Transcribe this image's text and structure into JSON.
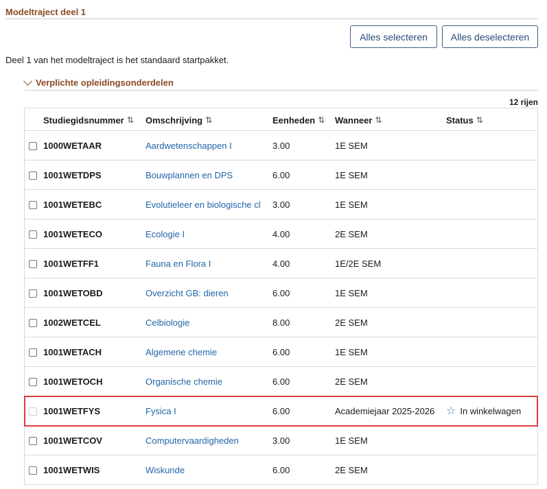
{
  "section": {
    "title": "Modeltraject deel 1",
    "intro": "Deel 1 van het modeltraject is het standaard startpakket."
  },
  "buttons": {
    "select_all": "Alles selecteren",
    "deselect_all": "Alles deselecteren"
  },
  "subsection": {
    "title": "Verplichte opleidingsonderdelen",
    "row_count": "12 rijen"
  },
  "table": {
    "headers": {
      "code": "Studiegidsnummer",
      "description": "Omschrijving",
      "units": "Eenheden",
      "when": "Wanneer",
      "status": "Status"
    },
    "sort_icon": "⇅",
    "rows": [
      {
        "code": "1000WETAAR",
        "description": "Aardwetenschappen I",
        "units": "3.00",
        "when": "1E SEM",
        "status": ""
      },
      {
        "code": "1001WETDPS",
        "description": "Bouwplannen en DPS",
        "units": "6.00",
        "when": "1E SEM",
        "status": ""
      },
      {
        "code": "1001WETEBC",
        "description": "Evolutieleer en biologische cl",
        "units": "3.00",
        "when": "1E SEM",
        "status": ""
      },
      {
        "code": "1001WETECO",
        "description": "Ecologie I",
        "units": "4.00",
        "when": "2E SEM",
        "status": ""
      },
      {
        "code": "1001WETFF1",
        "description": "Fauna en Flora I",
        "units": "4.00",
        "when": "1E/2E SEM",
        "status": ""
      },
      {
        "code": "1001WETOBD",
        "description": "Overzicht GB: dieren",
        "units": "6.00",
        "when": "1E SEM",
        "status": ""
      },
      {
        "code": "1002WETCEL",
        "description": "Celbiologie",
        "units": "8.00",
        "when": "2E SEM",
        "status": ""
      },
      {
        "code": "1001WETACH",
        "description": "Algemene chemie",
        "units": "6.00",
        "when": "1E SEM",
        "status": ""
      },
      {
        "code": "1001WETOCH",
        "description": "Organische chemie",
        "units": "6.00",
        "when": "2E SEM",
        "status": ""
      },
      {
        "code": "1001WETFYS",
        "description": "Fysica I",
        "units": "6.00",
        "when": "Academiejaar 2025-2026",
        "status": "In winkelwagen",
        "status_icon": "star-icon",
        "disabled": true,
        "highlighted": true
      },
      {
        "code": "1001WETCOV",
        "description": "Computervaardigheden",
        "units": "3.00",
        "when": "1E SEM",
        "status": ""
      },
      {
        "code": "1001WETWIS",
        "description": "Wiskunde",
        "units": "6.00",
        "when": "2E SEM",
        "status": ""
      }
    ]
  },
  "colors": {
    "accent_brown": "#8a4b22",
    "link_blue": "#2166a8",
    "highlight_red": "#e03c3c",
    "star_blue": "#4a6fa5"
  }
}
